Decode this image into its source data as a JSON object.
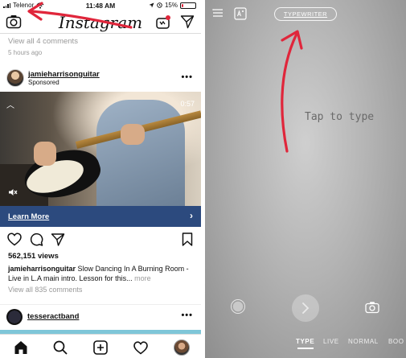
{
  "status_bar": {
    "carrier": "Telenor",
    "time": "11:48 AM",
    "battery": "15%",
    "battery_level": 0.15
  },
  "feed": {
    "app_title": "Instagram",
    "previous_post": {
      "view_comments": "View all 4 comments",
      "time_ago": "5 hours ago"
    },
    "sponsored_post": {
      "username": "jamieharrisonguitar",
      "label": "Sponsored",
      "video_time": "0:57",
      "cta": "Learn More",
      "views": "562,151 views",
      "caption_user": "jamieharrisonguitar",
      "caption_text": " Slow Dancing In A Burning Room - Live in L.A main intro. Lesson for this... ",
      "caption_more": "more",
      "view_comments": "View all 835 comments"
    },
    "next_post": {
      "username": "tesseractband"
    }
  },
  "story_editor": {
    "font_style": "TYPEWRITER",
    "placeholder": "Tap to type",
    "modes": [
      "TYPE",
      "LIVE",
      "NORMAL",
      "BOO"
    ],
    "active_mode": "TYPE"
  },
  "colors": {
    "annotation_arrow": "#e0263b",
    "learn_more_bar": "#2c4a7e",
    "notification_dot": "#e0263b"
  }
}
